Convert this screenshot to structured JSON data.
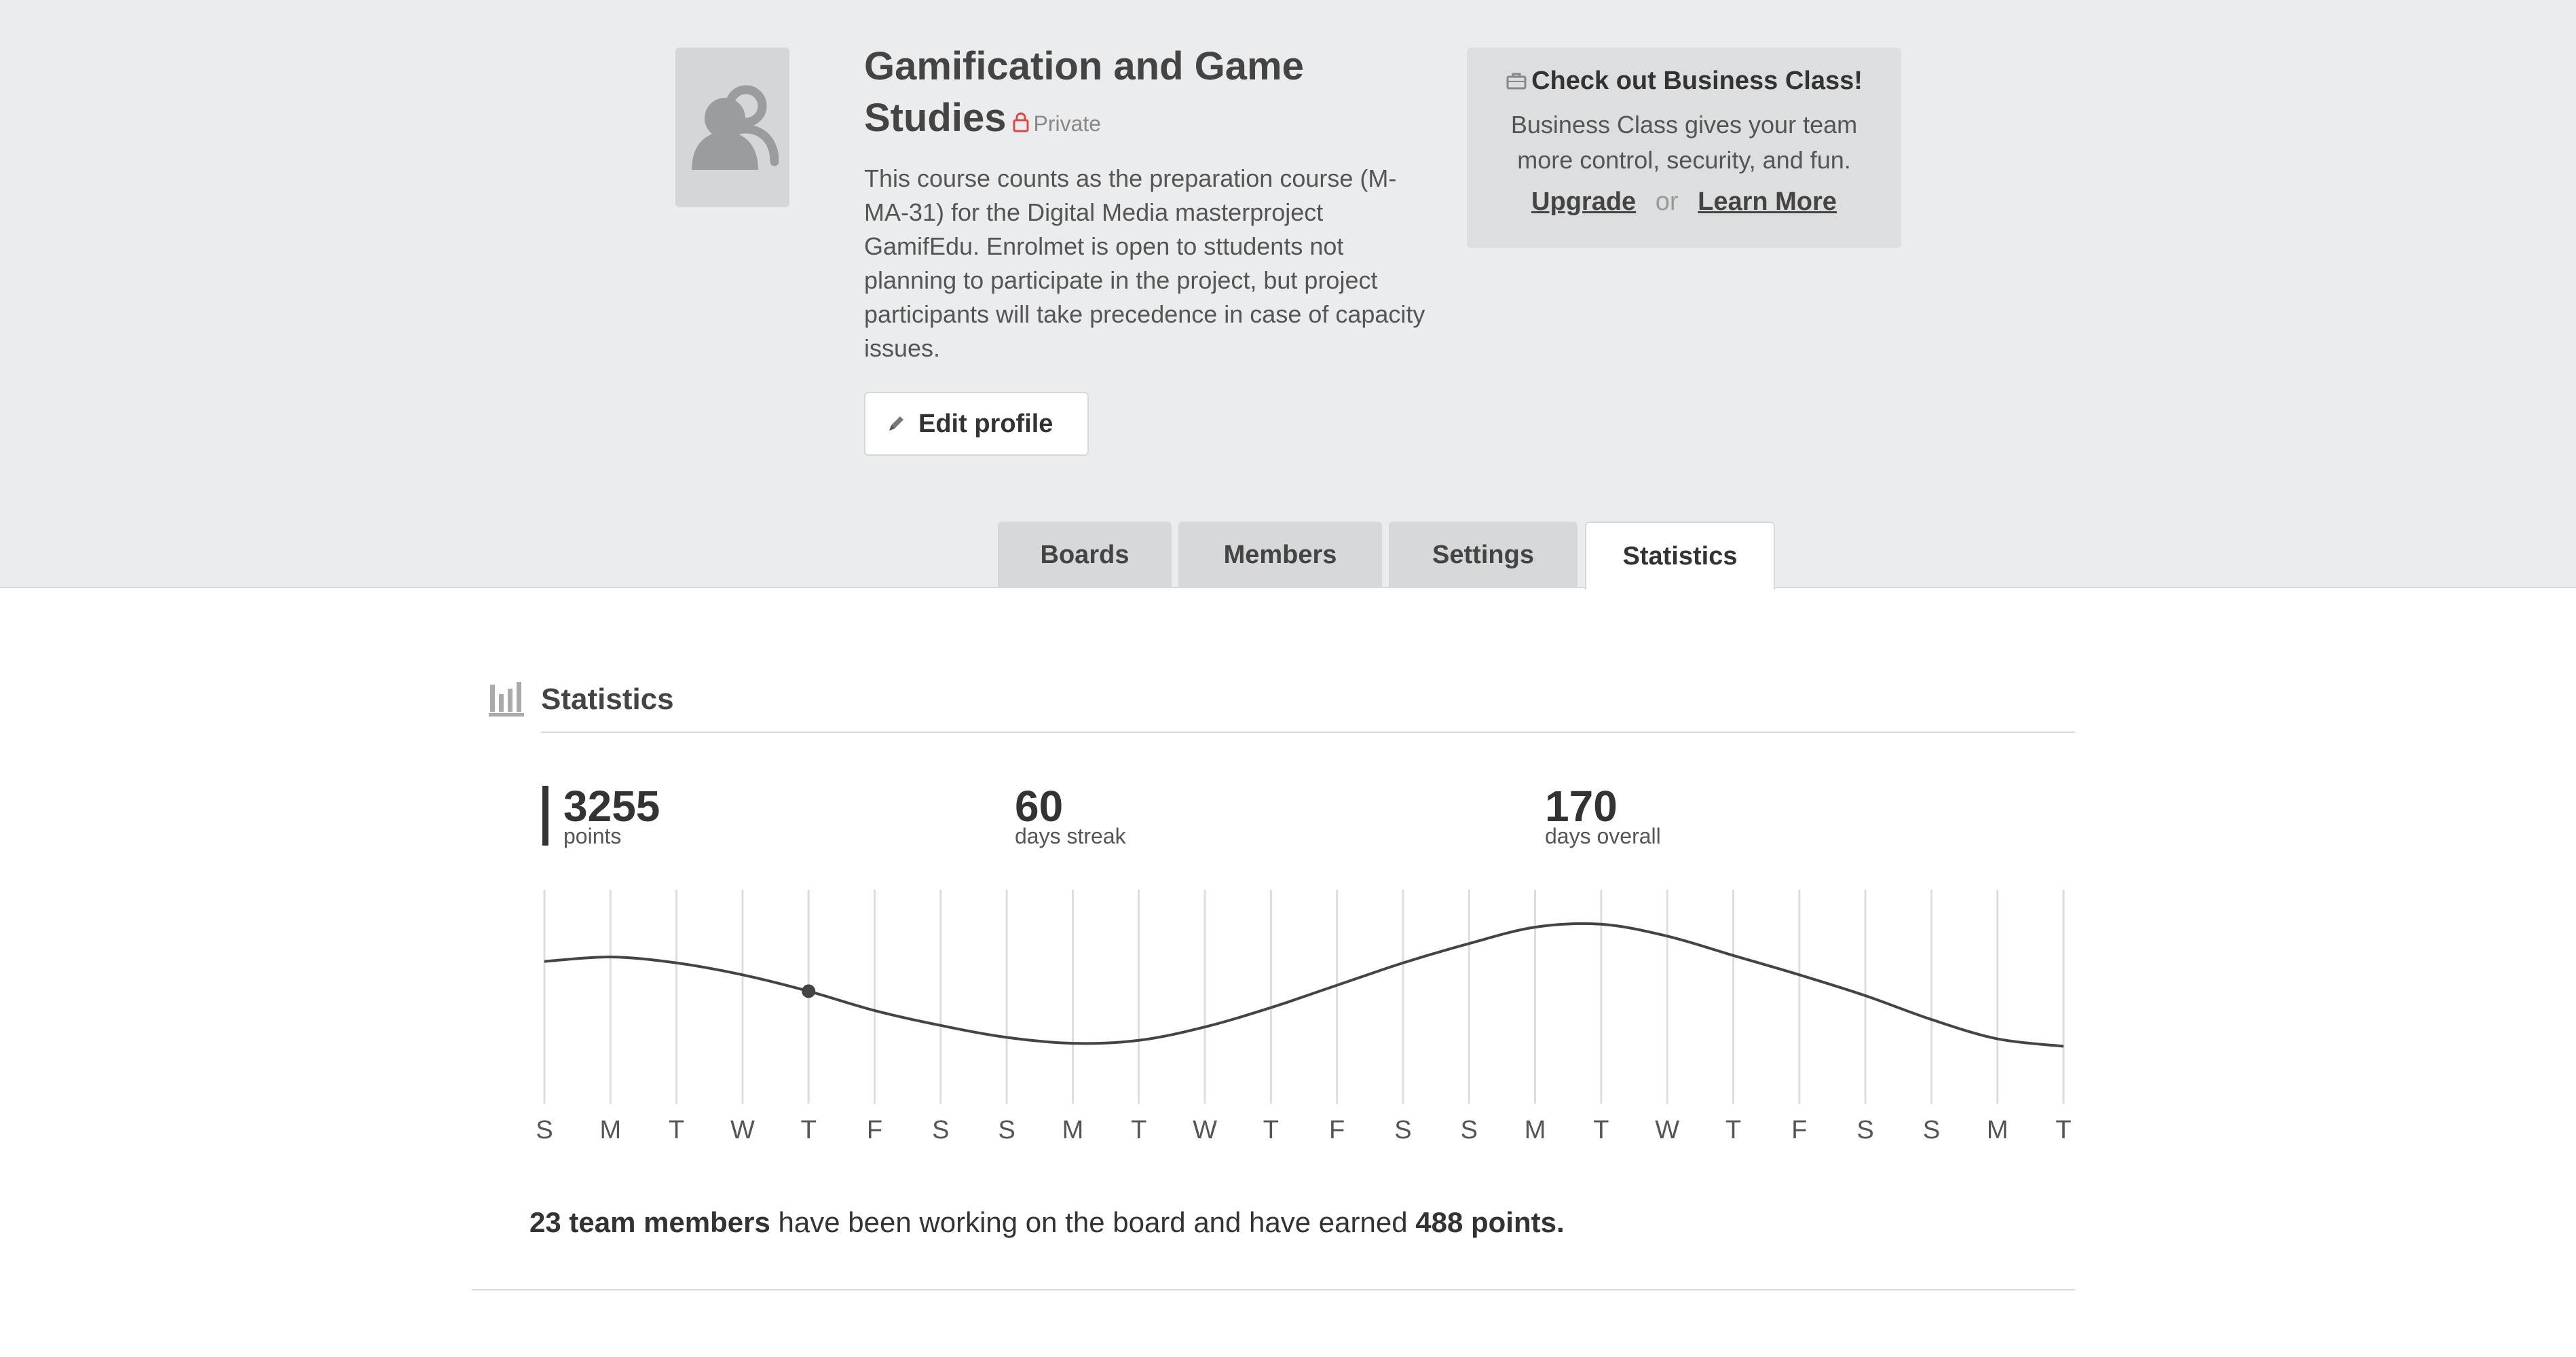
{
  "team": {
    "title": "Gamification and Game Studies",
    "privacy": "Private",
    "description": "This course counts as the preparation course (M-MA-31) for the Digital Media masterproject GamifEdu. Enrolmet is open to sttudents not planning to participate in the project, but project participants will take precedence in case of capacity issues.",
    "edit_profile_label": "Edit profile",
    "avatar_icon": "team-icon",
    "lock_icon": "lock-icon",
    "pencil_icon": "pencil-icon"
  },
  "business": {
    "title": "Check out Business Class!",
    "text": "Business Class gives your team more control, security, and fun.",
    "upgrade_label": "Upgrade",
    "or_label": "or",
    "learn_more_label": "Learn More",
    "icon": "briefcase-icon"
  },
  "tabs": [
    {
      "label": "Boards",
      "active": false
    },
    {
      "label": "Members",
      "active": false
    },
    {
      "label": "Settings",
      "active": false
    },
    {
      "label": "Statistics",
      "active": true
    }
  ],
  "statistics": {
    "heading": "Statistics",
    "icon": "bar-chart-icon",
    "points_value": "3255",
    "points_label": "points",
    "streak_value": "60",
    "streak_label": "days streak",
    "overall_value": "170",
    "overall_label": "days overall",
    "summary_members": "23 team members",
    "summary_middle": " have been working on the board and have earned ",
    "summary_points": "488 points."
  },
  "chart_data": {
    "type": "line",
    "categories": [
      "S",
      "M",
      "T",
      "W",
      "T",
      "F",
      "S",
      "S",
      "M",
      "T",
      "W",
      "T",
      "F",
      "S",
      "S",
      "M",
      "T",
      "W",
      "T",
      "F",
      "S",
      "S",
      "M",
      "T"
    ],
    "values": [
      0.45,
      0.48,
      0.44,
      0.36,
      0.25,
      0.12,
      0.02,
      -0.06,
      -0.1,
      -0.08,
      0.01,
      0.14,
      0.29,
      0.44,
      0.57,
      0.68,
      0.7,
      0.62,
      0.49,
      0.36,
      0.22,
      0.06,
      -0.07,
      -0.12
    ],
    "highlighted_index": 4,
    "ylim": [
      -0.3,
      1.0
    ],
    "grid": true,
    "line_color": "#444444",
    "grid_color": "#dddddd"
  }
}
